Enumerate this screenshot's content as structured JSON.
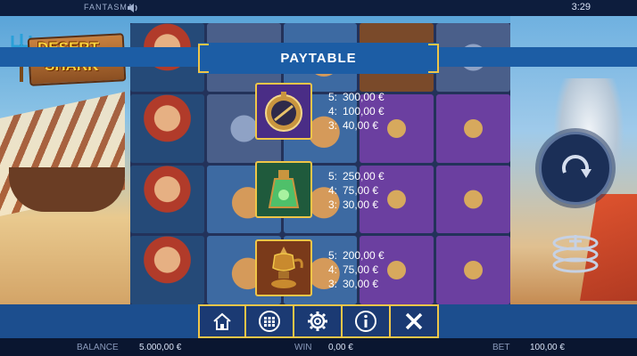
{
  "top_bar": {
    "brand": "FANTASMA",
    "clock": "3:29",
    "sound_icon": "speaker-icon"
  },
  "logo": {
    "line1": "DESERT",
    "line2": "SHARK"
  },
  "paytable": {
    "title": "PAYTABLE",
    "entries": [
      {
        "symbol": "compass-icon",
        "pays": [
          {
            "count": "5:",
            "amount": "300,00 €"
          },
          {
            "count": "4:",
            "amount": "100,00 €"
          },
          {
            "count": "3:",
            "amount": "40,00 €"
          }
        ]
      },
      {
        "symbol": "potion-bottle-icon",
        "pays": [
          {
            "count": "5:",
            "amount": "250,00 €"
          },
          {
            "count": "4:",
            "amount": "75,00 €"
          },
          {
            "count": "3:",
            "amount": "30,00 €"
          }
        ]
      },
      {
        "symbol": "oil-lamp-icon",
        "pays": [
          {
            "count": "5:",
            "amount": "200,00 €"
          },
          {
            "count": "4:",
            "amount": "75,00 €"
          },
          {
            "count": "3:",
            "amount": "30,00 €"
          }
        ]
      }
    ]
  },
  "menu": {
    "buttons": [
      "home-icon",
      "grid-menu-icon",
      "settings-gear-icon",
      "info-icon",
      "close-icon"
    ]
  },
  "controls": {
    "spin": "spin-arrow-icon",
    "bet": "coin-stack-icon"
  },
  "footer": {
    "balance_label": "BALANCE",
    "balance_value": "5.000,00 €",
    "win_label": "WIN",
    "win_value": "0,00 €",
    "bet_label": "BET",
    "bet_value": "100,00 €"
  },
  "colors": {
    "band_blue": "#1c5da5",
    "gold_border": "#f0c648",
    "button_bg": "#1b3a73"
  }
}
